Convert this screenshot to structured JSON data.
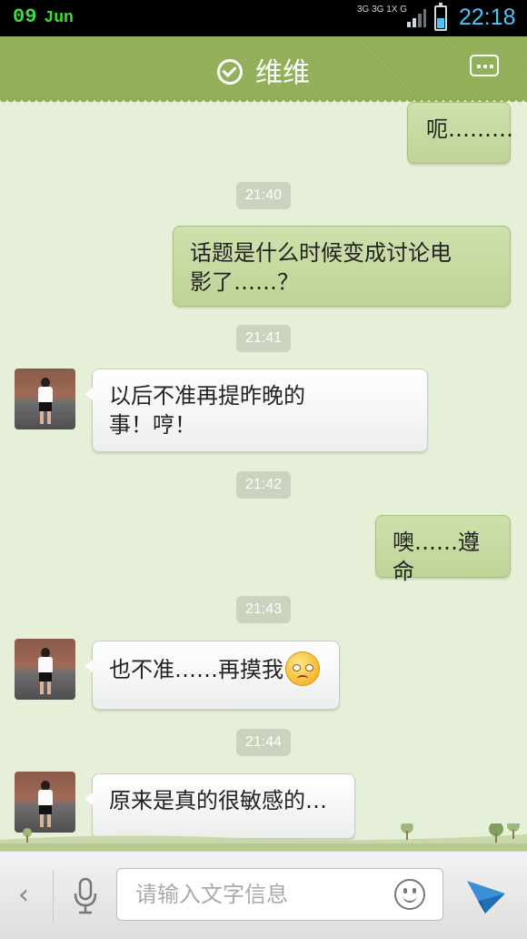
{
  "status_bar": {
    "date_day": "09",
    "date_month": "Jun",
    "network": [
      "3G",
      "3G",
      "1X",
      "G"
    ],
    "time": "22:18",
    "battery_level": 0.45
  },
  "header": {
    "title": "维维",
    "verified_icon": "check-circle-icon",
    "menu_icon": "more-icon"
  },
  "messages": [
    {
      "type": "out",
      "text": "呃………"
    },
    {
      "type": "time",
      "text": "21:40"
    },
    {
      "type": "out",
      "lines": [
        "话题是什么时候变成讨论电",
        "影了……？"
      ]
    },
    {
      "type": "time",
      "text": "21:41"
    },
    {
      "type": "in",
      "lines": [
        "以后不准再提昨晚的",
        "事！哼！"
      ]
    },
    {
      "type": "time",
      "text": "21:42"
    },
    {
      "type": "out",
      "text": "噢……遵命"
    },
    {
      "type": "time",
      "text": "21:43"
    },
    {
      "type": "in",
      "text": "也不准……再摸我",
      "emoji": "worried-face-icon"
    },
    {
      "type": "time",
      "text": "21:44"
    },
    {
      "type": "in",
      "text": "原来是真的很敏感的…"
    }
  ],
  "input_bar": {
    "back_icon": "chevron-left-icon",
    "mic_icon": "microphone-icon",
    "placeholder": "请输入文字信息",
    "emoji_icon": "smiley-icon",
    "send_icon": "send-icon"
  }
}
